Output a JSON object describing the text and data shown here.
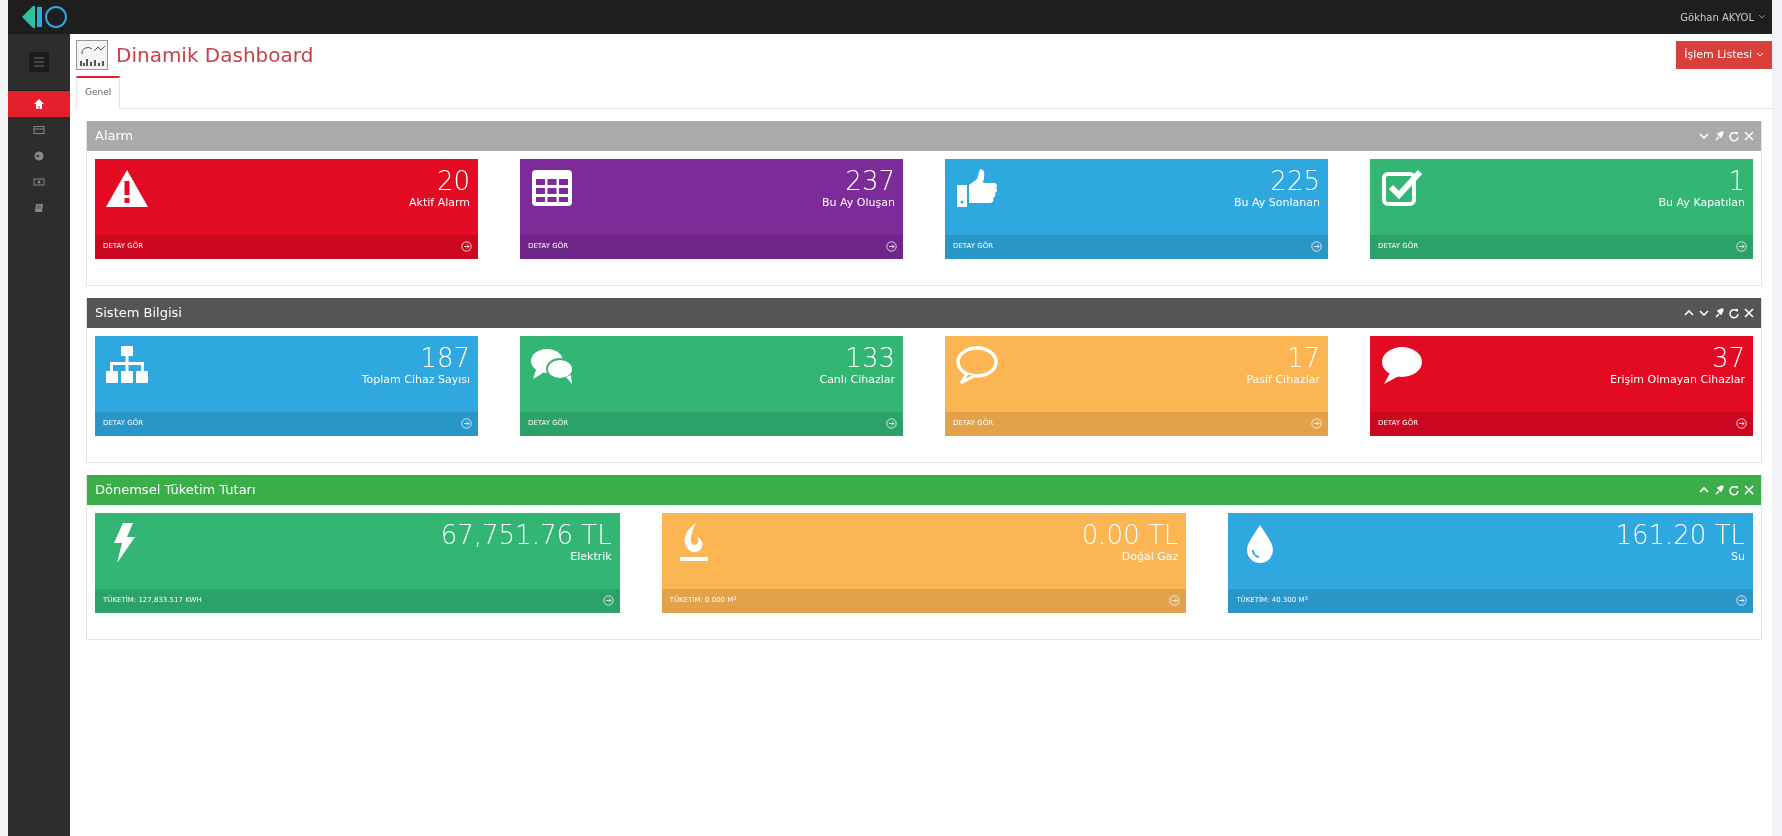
{
  "topbar": {
    "user": "Gökhan AKYOL"
  },
  "sidebar": {
    "items": [
      {
        "kind": "home",
        "selected": true
      },
      {
        "kind": "card",
        "selected": false
      },
      {
        "kind": "globe",
        "selected": false
      },
      {
        "kind": "money",
        "selected": false
      },
      {
        "kind": "book",
        "selected": false
      }
    ]
  },
  "page": {
    "title": "Dinamik Dashboard",
    "action_button": "İşlem Listesi"
  },
  "tabs": [
    {
      "label": "Genel",
      "selected": true
    }
  ],
  "panels": [
    {
      "title": "Alarm",
      "color": "#aaaaaa",
      "move_up": false,
      "move_down": true,
      "tiles": [
        {
          "kind": "warning",
          "color": "#e30a23",
          "value": "20",
          "label": "Aktif Alarm",
          "footer": "DETAY GÖR"
        },
        {
          "kind": "table",
          "color": "#7d2b98",
          "value": "237",
          "label": "Bu Ay Oluşan",
          "footer": "DETAY GÖR"
        },
        {
          "kind": "thumbs-up",
          "color": "#2fa7df",
          "value": "225",
          "label": "Bu Ay Sonlanan",
          "footer": "DETAY GÖR"
        },
        {
          "kind": "checkbox",
          "color": "#33b574",
          "value": "1",
          "label": "Bu Ay Kapatılan",
          "footer": "DETAY GÖR"
        }
      ]
    },
    {
      "title": "Sistem Bilgisi",
      "color": "#555555",
      "move_up": true,
      "move_down": true,
      "tiles": [
        {
          "kind": "sitemap",
          "color": "#2fa7df",
          "value": "187",
          "label": "Toplam Cihaz Sayısı",
          "footer": "DETAY GÖR"
        },
        {
          "kind": "comments",
          "color": "#33b574",
          "value": "133",
          "label": "Canlı Cihazlar",
          "footer": "DETAY GÖR"
        },
        {
          "kind": "comment-outline",
          "color": "#fbb553",
          "value": "17",
          "label": "Pasif Cihazlar",
          "footer": "DETAY GÖR"
        },
        {
          "kind": "comment",
          "color": "#e30a23",
          "value": "37",
          "label": "Erişim Olmayan Cihazlar",
          "footer": "DETAY GÖR"
        }
      ]
    },
    {
      "title": "Dönemsel Tüketim Tutarı",
      "color": "#3cae49",
      "move_up": true,
      "move_down": false,
      "tiles": [
        {
          "kind": "bolt",
          "color": "#33b574",
          "value": "67,751.76 TL",
          "label": "Elektrik",
          "footer": "TÜKETİM: 127,833.517 KWH"
        },
        {
          "kind": "fire",
          "color": "#fbb553",
          "value": "0.00 TL",
          "label": "Doğal Gaz",
          "footer": "TÜKETİM: 0.000 M$^{3}$"
        },
        {
          "kind": "drop",
          "color": "#2fa7df",
          "value": "161.20 TL",
          "label": "Su",
          "footer": "TÜKETİM: 40.300 M$^{3}$"
        }
      ]
    }
  ]
}
